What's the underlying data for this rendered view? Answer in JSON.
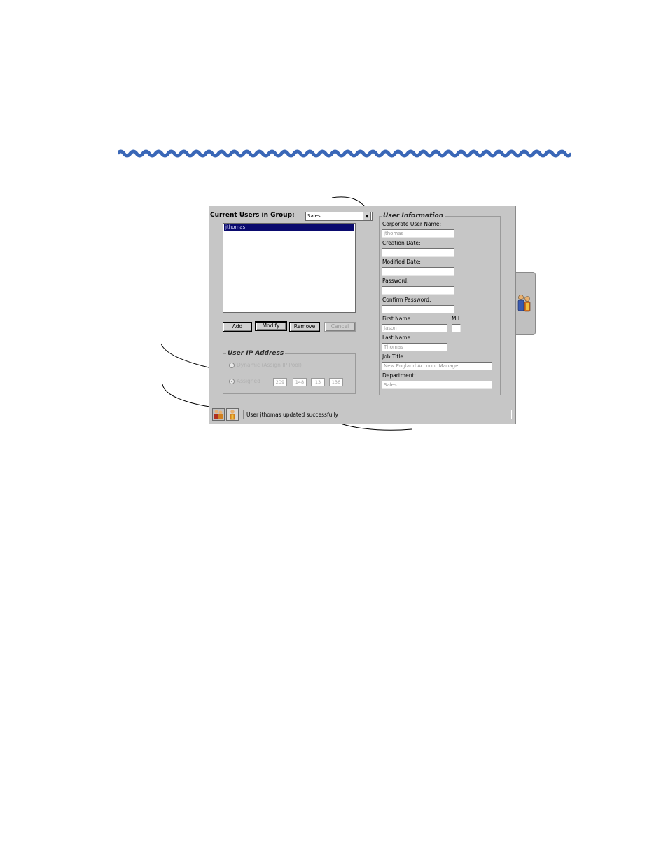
{
  "group_header": {
    "label": "Current Users in Group:",
    "selected_group": "Sales"
  },
  "users_list": {
    "items": [
      "jthomas"
    ]
  },
  "buttons": {
    "add": "Add",
    "modify": "Modify",
    "remove": "Remove",
    "cancel": "Cancel"
  },
  "ip_section": {
    "title": "User IP Address",
    "option_dynamic": "Dynamic (Assign IP Pool)",
    "option_static": "Assigned",
    "octets": [
      "209",
      "148",
      "13",
      "136"
    ]
  },
  "user_info": {
    "title": "User Information",
    "fields": {
      "corporate_user_name": {
        "label": "Corporate User Name:",
        "value": "jthomas"
      },
      "creation_date": {
        "label": "Creation Date:",
        "value": ""
      },
      "modified_date": {
        "label": "Modified Date:",
        "value": ""
      },
      "password": {
        "label": "Password:",
        "value": ""
      },
      "confirm_password": {
        "label": "Confirm Password:",
        "value": ""
      },
      "first_name": {
        "label": "First Name:",
        "value": "Jason"
      },
      "mi": {
        "label": "M.I",
        "value": ""
      },
      "last_name": {
        "label": "Last Name:",
        "value": "Thomas"
      },
      "job_title": {
        "label": "Job Title:",
        "value": "New England Account Manager"
      },
      "department": {
        "label": "Department:",
        "value": "Sales"
      }
    }
  },
  "status": {
    "message": "User jthomas updated successfully"
  },
  "colors": {
    "accent_wave": "#3a67b7",
    "selection": "#0a0a6e",
    "panel": "#c6c6c6"
  },
  "icons": {
    "side_tab": "users-group-icon",
    "toolbar_1": "users-group-icon",
    "toolbar_2": "single-user-icon",
    "dropdown": "chevron-down-icon"
  }
}
